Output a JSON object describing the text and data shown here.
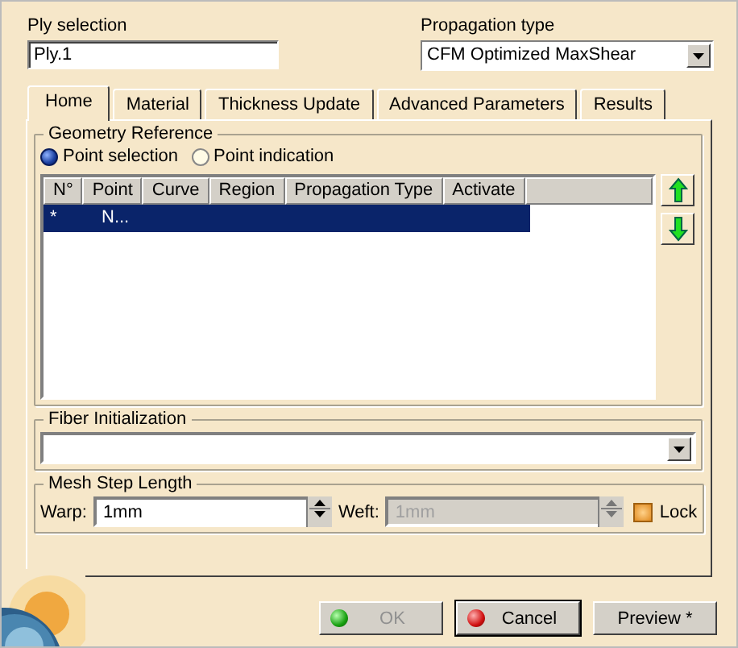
{
  "ply_selection": {
    "label": "Ply selection",
    "value": "Ply.1"
  },
  "propagation_type": {
    "label": "Propagation type",
    "value": "CFM Optimized MaxShear"
  },
  "tabs": [
    {
      "label": "Home",
      "selected": true
    },
    {
      "label": "Material",
      "selected": false
    },
    {
      "label": "Thickness Update",
      "selected": false
    },
    {
      "label": "Advanced Parameters",
      "selected": false
    },
    {
      "label": "Results",
      "selected": false
    }
  ],
  "geometry_reference": {
    "title": "Geometry Reference",
    "radios": [
      {
        "label": "Point selection",
        "selected": true
      },
      {
        "label": "Point indication",
        "selected": false
      }
    ],
    "table": {
      "columns": [
        "N°",
        "Point",
        "Curve",
        "Region",
        "Propagation Type",
        "Activate"
      ],
      "rows": [
        {
          "cells": [
            "*",
            "N..."
          ],
          "selected": true
        }
      ]
    }
  },
  "fiber_initialization": {
    "title": "Fiber Initialization"
  },
  "mesh_step_length": {
    "title": "Mesh Step Length",
    "warp": {
      "label": "Warp:",
      "value": "1mm",
      "disabled": false
    },
    "weft": {
      "label": "Weft:",
      "value": "1mm",
      "disabled": true
    },
    "lock": {
      "label": "Lock",
      "checked": false
    }
  },
  "buttons": [
    {
      "label": "OK",
      "kind": "ok",
      "disabled": true,
      "focused": false
    },
    {
      "label": "Cancel",
      "kind": "cancel",
      "disabled": false,
      "focused": true
    },
    {
      "label": "Preview *",
      "kind": "plain",
      "disabled": false,
      "focused": false
    }
  ]
}
